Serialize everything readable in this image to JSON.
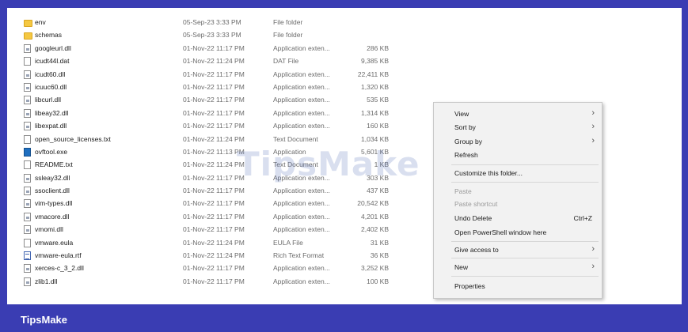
{
  "files": [
    {
      "name": "env",
      "date": "05-Sep-23 3:33 PM",
      "type": "File folder",
      "size": "",
      "icon": "folder-icon"
    },
    {
      "name": "schemas",
      "date": "05-Sep-23 3:33 PM",
      "type": "File folder",
      "size": "",
      "icon": "folder-icon"
    },
    {
      "name": "googleurl.dll",
      "date": "01-Nov-22 11:17 PM",
      "type": "Application exten...",
      "size": "286 KB",
      "icon": "dll-file-icon"
    },
    {
      "name": "icudt44l.dat",
      "date": "01-Nov-22 11:24 PM",
      "type": "DAT File",
      "size": "9,385 KB",
      "icon": "dat-file-icon"
    },
    {
      "name": "icudt60.dll",
      "date": "01-Nov-22 11:17 PM",
      "type": "Application exten...",
      "size": "22,411 KB",
      "icon": "dll-file-icon"
    },
    {
      "name": "icuuc60.dll",
      "date": "01-Nov-22 11:17 PM",
      "type": "Application exten...",
      "size": "1,320 KB",
      "icon": "dll-file-icon"
    },
    {
      "name": "libcurl.dll",
      "date": "01-Nov-22 11:17 PM",
      "type": "Application exten...",
      "size": "535 KB",
      "icon": "dll-file-icon"
    },
    {
      "name": "libeay32.dll",
      "date": "01-Nov-22 11:17 PM",
      "type": "Application exten...",
      "size": "1,314 KB",
      "icon": "dll-file-icon"
    },
    {
      "name": "libexpat.dll",
      "date": "01-Nov-22 11:17 PM",
      "type": "Application exten...",
      "size": "160 KB",
      "icon": "dll-file-icon"
    },
    {
      "name": "open_source_licenses.txt",
      "date": "01-Nov-22 11:24 PM",
      "type": "Text Document",
      "size": "1,034 KB",
      "icon": "text-file-icon"
    },
    {
      "name": "ovftool.exe",
      "date": "01-Nov-22 11:13 PM",
      "type": "Application",
      "size": "5,601 KB",
      "icon": "exe-file-icon"
    },
    {
      "name": "README.txt",
      "date": "01-Nov-22 11:24 PM",
      "type": "Text Document",
      "size": "1 KB",
      "icon": "text-file-icon"
    },
    {
      "name": "ssleay32.dll",
      "date": "01-Nov-22 11:17 PM",
      "type": "Application exten...",
      "size": "303 KB",
      "icon": "dll-file-icon"
    },
    {
      "name": "ssoclient.dll",
      "date": "01-Nov-22 11:17 PM",
      "type": "Application exten...",
      "size": "437 KB",
      "icon": "dll-file-icon"
    },
    {
      "name": "vim-types.dll",
      "date": "01-Nov-22 11:17 PM",
      "type": "Application exten...",
      "size": "20,542 KB",
      "icon": "dll-file-icon"
    },
    {
      "name": "vmacore.dll",
      "date": "01-Nov-22 11:17 PM",
      "type": "Application exten...",
      "size": "4,201 KB",
      "icon": "dll-file-icon"
    },
    {
      "name": "vmomi.dll",
      "date": "01-Nov-22 11:17 PM",
      "type": "Application exten...",
      "size": "2,402 KB",
      "icon": "dll-file-icon"
    },
    {
      "name": "vmware.eula",
      "date": "01-Nov-22 11:24 PM",
      "type": "EULA File",
      "size": "31 KB",
      "icon": "eula-file-icon"
    },
    {
      "name": "vmware-eula.rtf",
      "date": "01-Nov-22 11:24 PM",
      "type": "Rich Text Format",
      "size": "36 KB",
      "icon": "rtf-file-icon"
    },
    {
      "name": "xerces-c_3_2.dll",
      "date": "01-Nov-22 11:17 PM",
      "type": "Application exten...",
      "size": "3,252 KB",
      "icon": "dll-file-icon"
    },
    {
      "name": "zlib1.dll",
      "date": "01-Nov-22 11:17 PM",
      "type": "Application exten...",
      "size": "100 KB",
      "icon": "dll-file-icon"
    }
  ],
  "context_menu": {
    "view": "View",
    "sort_by": "Sort by",
    "group_by": "Group by",
    "refresh": "Refresh",
    "customize": "Customize this folder...",
    "paste": "Paste",
    "paste_shortcut": "Paste shortcut",
    "undo_delete": "Undo Delete",
    "undo_shortcut": "Ctrl+Z",
    "open_powershell": "Open PowerShell window here",
    "give_access": "Give access to",
    "new": "New",
    "properties": "Properties",
    "chevron": "›"
  },
  "watermark": "TipsMake",
  "footer": {
    "brand": "TipsMake"
  },
  "colors": {
    "frame": "#3a3db3",
    "folder": "#f5c842",
    "menu_bg": "#f2f2f2"
  }
}
